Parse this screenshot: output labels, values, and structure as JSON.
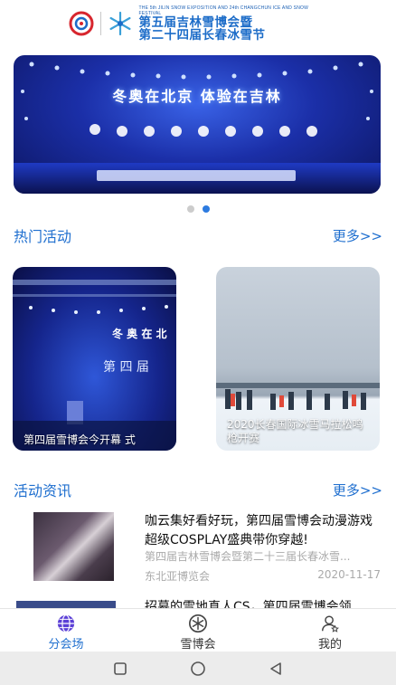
{
  "header": {
    "en_text": "THE 5th JILIN SNOW EXPOSITION AND 24th CHANGCHUN ICE AND SNOW FESTIVAL",
    "title_line1": "第五届吉林雪博会暨",
    "title_line2": "第二十四届长春冰雪节"
  },
  "banner": {
    "title": "冬奥在北京 体验在吉林",
    "slide_count": 2,
    "active_slide": 2
  },
  "hot_activities": {
    "title": "热门活动",
    "more_label": "更多>>",
    "cards": [
      {
        "caption": "第四届雪博会今开幕 式"
      },
      {
        "caption": "2020长春国际冰雪马拉松鸣枪开赛"
      }
    ]
  },
  "news": {
    "title": "活动资讯",
    "more_label": "更多>>",
    "items": [
      {
        "title": "咖云集好看好玩，第四届雪博会动漫游戏超级COSPLAY盛典带你穿越!",
        "subtitle": "第四届吉林雪博会暨第二十三届长春冰雪...",
        "source": "东北亚博览会",
        "date": "2020-11-17"
      },
      {
        "title": "招募的雪地真人CS，第四届雪博会领"
      }
    ]
  },
  "tabbar": {
    "tabs": [
      {
        "label": "分会场",
        "icon": "globe-icon",
        "active": true
      },
      {
        "label": "雪博会",
        "icon": "snowflake-icon",
        "active": false
      },
      {
        "label": "我的",
        "icon": "user-icon",
        "active": false
      }
    ]
  },
  "colors": {
    "accent": "#1f6fcf",
    "dot_inactive": "#cccccc",
    "dot_active": "#2d7be0"
  }
}
